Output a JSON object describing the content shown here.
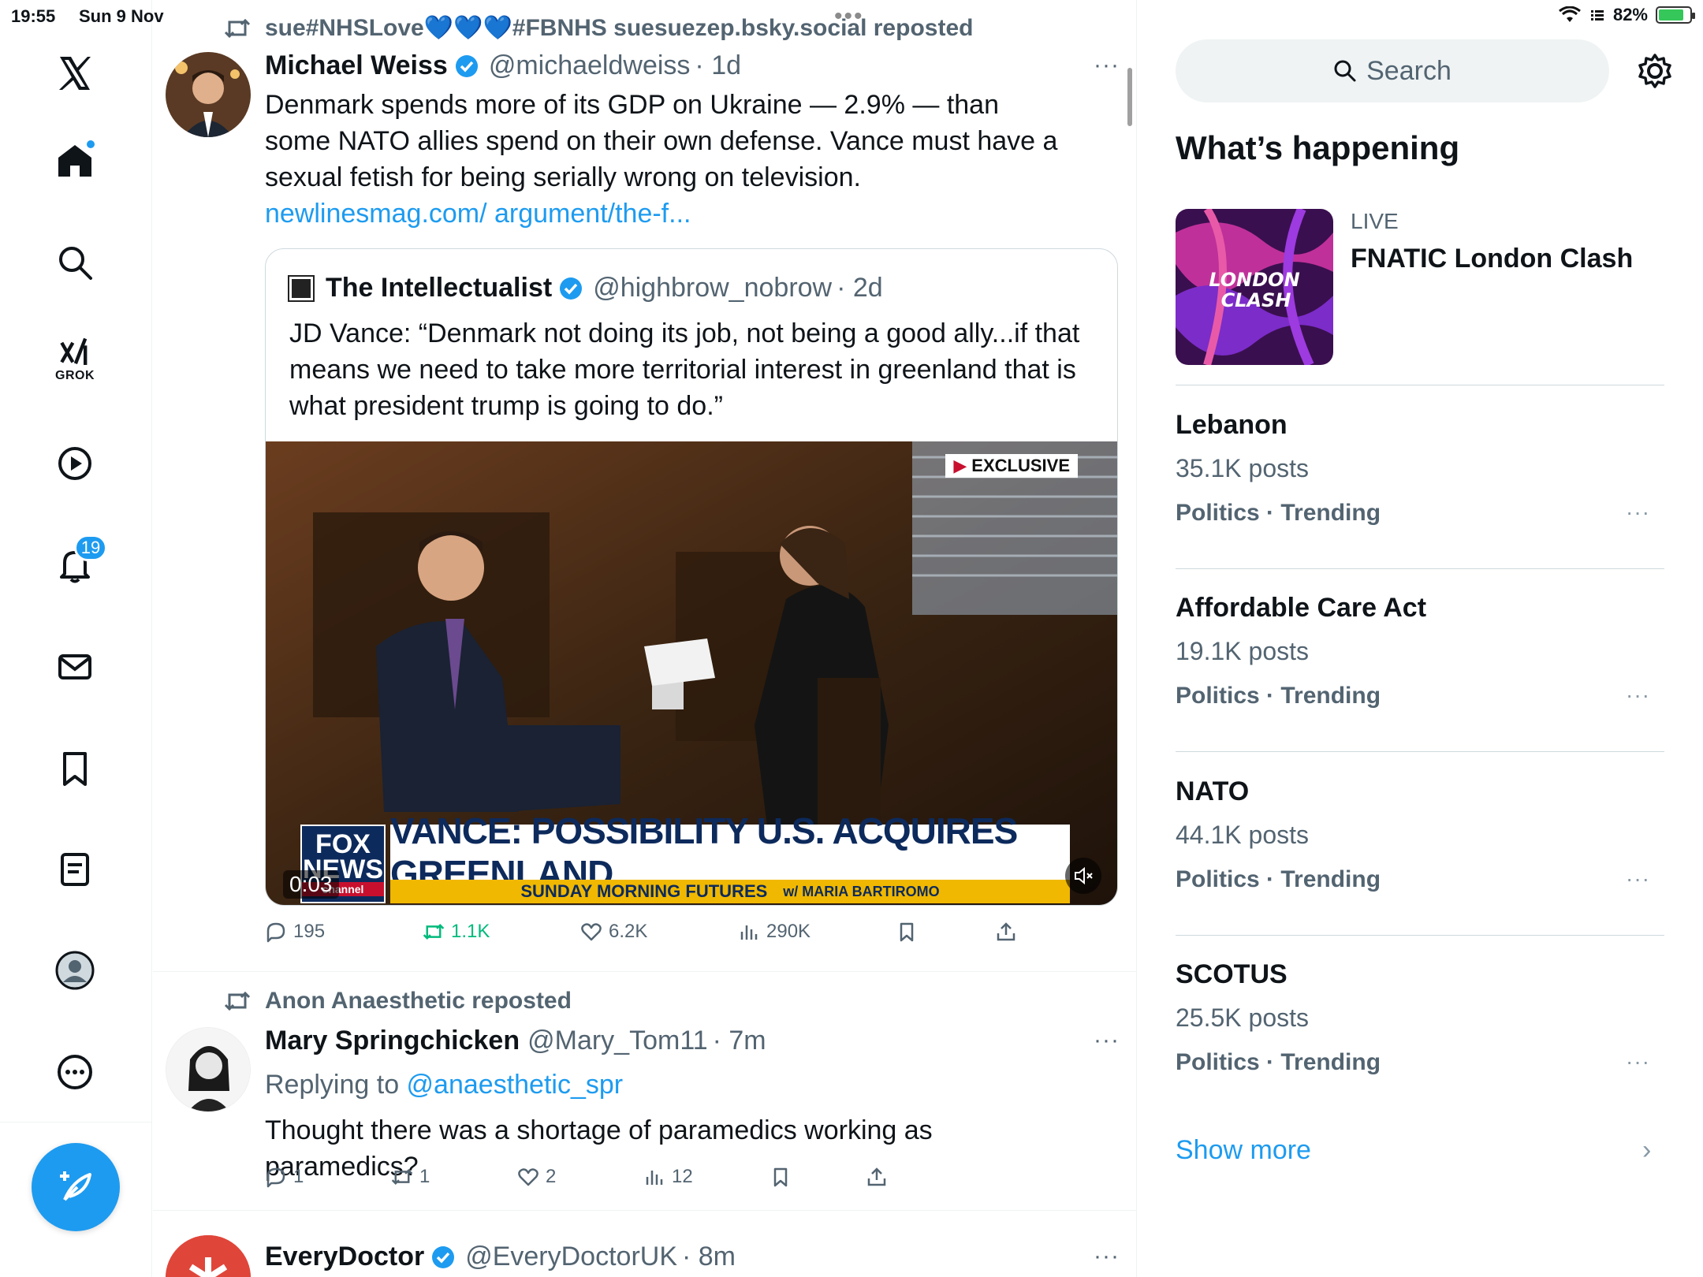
{
  "status_bar": {
    "time": "19:55",
    "date": "Sun 9 Nov",
    "battery": "82%",
    "battery_level": 0.82,
    "multitask_dots": "•••"
  },
  "nav": {
    "grok_label": "GROK",
    "notifications_badge": "19",
    "colors": {
      "accent": "#1d9bf0"
    }
  },
  "feed": {
    "tweets": [
      {
        "repost_by": "sue#NHSLove💙💙💙#FBNHS suesuezep.bsky.social reposted",
        "name": "Michael Weiss",
        "handle": "@michaeldweiss",
        "time": "· 1d",
        "more": "···",
        "text": "Denmark spends more of its GDP on Ukraine — 2.9% — than some NATO allies spend on their own defense. Vance must have a sexual fetish for being serially wrong on television. ",
        "link": "newlinesmag.com/ argument/the-f...",
        "quote": {
          "name": "The Intellectualist",
          "handle": "@highbrow_nobrow",
          "time": "· 2d",
          "text": "JD Vance: “Denmark not doing its job, not being a good ally...if that means we need to take more territorial interest in greenland that is what president trump is going to do.”",
          "video": {
            "timestamp": "0:03",
            "exclusive": "EXCLUSIVE",
            "chyron": "VANCE: POSSIBILITY U.S. ACQUIRES GREENLAND",
            "chyron_sub_left": "SUNDAY MORNING FUTURES",
            "chyron_sub_right": "w/ MARIA BARTIROMO",
            "network_top": "FOX",
            "network_mid": "NEWS",
            "network_bottom": "channel"
          }
        },
        "replies": "195",
        "reposts": "1.1K",
        "likes": "6.2K",
        "views": "290K"
      },
      {
        "repost_by": "Anon Anaesthetic reposted",
        "name": "Mary Springchicken",
        "handle": "@Mary_Tom11",
        "time": "· 7m",
        "more": "···",
        "replying_prefix": "Replying to ",
        "replying_to": "@anaesthetic_spr",
        "text": "Thought there was a shortage of paramedics working as paramedics?",
        "replies": "1",
        "reposts": "1",
        "likes": "2",
        "views": "12"
      },
      {
        "name": "EveryDoctor",
        "handle": "@EveryDoctorUK",
        "time": "· 8m",
        "more": "···"
      }
    ]
  },
  "right": {
    "search_placeholder": "Search",
    "whats_happening": "What’s happening",
    "live": {
      "label": "LIVE",
      "title": "FNATIC London Clash",
      "thumb_text_1": "LONDON",
      "thumb_text_2": "CLASH"
    },
    "trends": [
      {
        "name": "Lebanon",
        "count": "35.1K posts",
        "category": "Politics · Trending"
      },
      {
        "name": "Affordable Care Act",
        "count": "19.1K posts",
        "category": "Politics · Trending"
      },
      {
        "name": "NATO",
        "count": "44.1K posts",
        "category": "Politics · Trending"
      },
      {
        "name": "SCOTUS",
        "count": "25.5K posts",
        "category": "Politics · Trending"
      }
    ],
    "trend_more": "···",
    "show_more": "Show more",
    "show_more_chevron": "›"
  }
}
